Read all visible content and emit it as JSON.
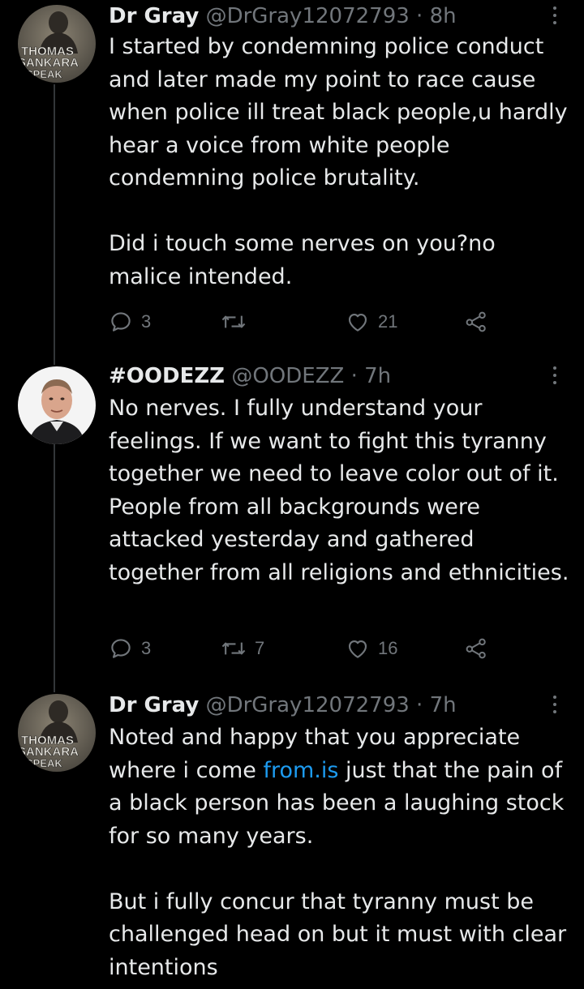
{
  "tweets": [
    {
      "name": "Dr Gray",
      "handle": "@DrGray12072793",
      "separator": "·",
      "time": "8h",
      "avatar_text": [
        "THOMAS",
        "SANKARA",
        "SPEAK"
      ],
      "paragraphs": [
        "I started by condemning police conduct and later made my point to race cause when police ill treat black people,u hardly hear a voice from white people condemning police brutality.",
        "Did i touch some nerves on you?no malice intended."
      ],
      "replies": "3",
      "retweets": "",
      "likes": "21"
    },
    {
      "name": "#OODEZZ",
      "handle": "@OODEZZ",
      "separator": "·",
      "time": "7h",
      "paragraphs": [
        "No nerves. I fully understand your feelings. If we want to fight this tyranny together we need to leave color out of it. People from all backgrounds were attacked yesterday and gathered together from all religions and ethnicities."
      ],
      "replies": "3",
      "retweets": "7",
      "likes": "16"
    },
    {
      "name": "Dr Gray",
      "handle": "@DrGray12072793",
      "separator": "·",
      "time": "7h",
      "avatar_text": [
        "THOMAS",
        "SANKARA",
        "SPEAK"
      ],
      "paragraph1_before": "Noted and happy that you appreciate where i come ",
      "paragraph1_link": "from.is",
      "paragraph1_after": " just that the pain of a black person has been a laughing stock for so many years.",
      "paragraph2": "But i fully concur that tyranny must be challenged head on but it must with clear intentions"
    }
  ],
  "colors": {
    "background": "#000000",
    "text": "#e7e9ea",
    "secondary": "#71767b",
    "link": "#1d9bf0",
    "thread_line": "#333639"
  }
}
